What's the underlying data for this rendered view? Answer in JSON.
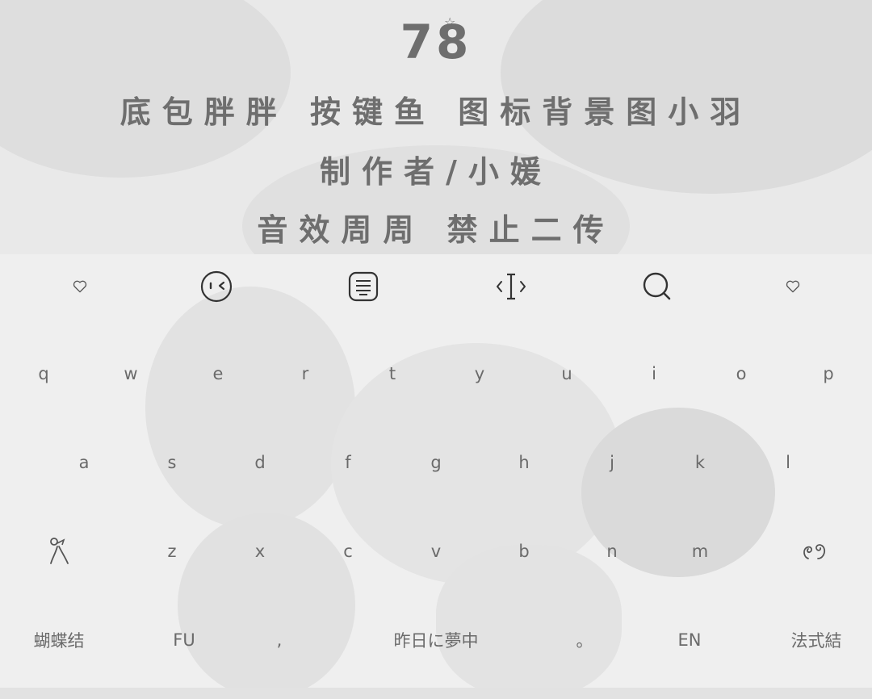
{
  "banner": {
    "number": "78",
    "credit_line_1": "底包胖胖  按键鱼  图标背景图小羽",
    "credit_line_2": "制作者/小媛",
    "credit_line_3": "音效周周   禁止二传"
  },
  "toolbar": {
    "icons": [
      "heart-icon",
      "emoji-face-icon",
      "keyboard-layout-icon",
      "cursor-move-icon",
      "search-icon",
      "heart-icon"
    ]
  },
  "keys": {
    "row1": [
      "q",
      "w",
      "e",
      "r",
      "t",
      "y",
      "u",
      "i",
      "o",
      "p"
    ],
    "row2": [
      "a",
      "s",
      "d",
      "f",
      "g",
      "h",
      "j",
      "k",
      "l"
    ],
    "row3": [
      "z",
      "x",
      "c",
      "v",
      "b",
      "n",
      "m"
    ],
    "shift_icon": "bow-figure-icon",
    "backspace_icon": "curl-figure-icon"
  },
  "bottom_row": {
    "left": "蝴蝶结",
    "fu": "FU",
    "comma": ",",
    "space": "昨日に夢中",
    "period": "。",
    "lang": "EN",
    "right": "法式結"
  },
  "colors": {
    "text": "#6a6a6a",
    "banner_bg": "#e9e9e9",
    "keyboard_bg": "#efefef"
  }
}
